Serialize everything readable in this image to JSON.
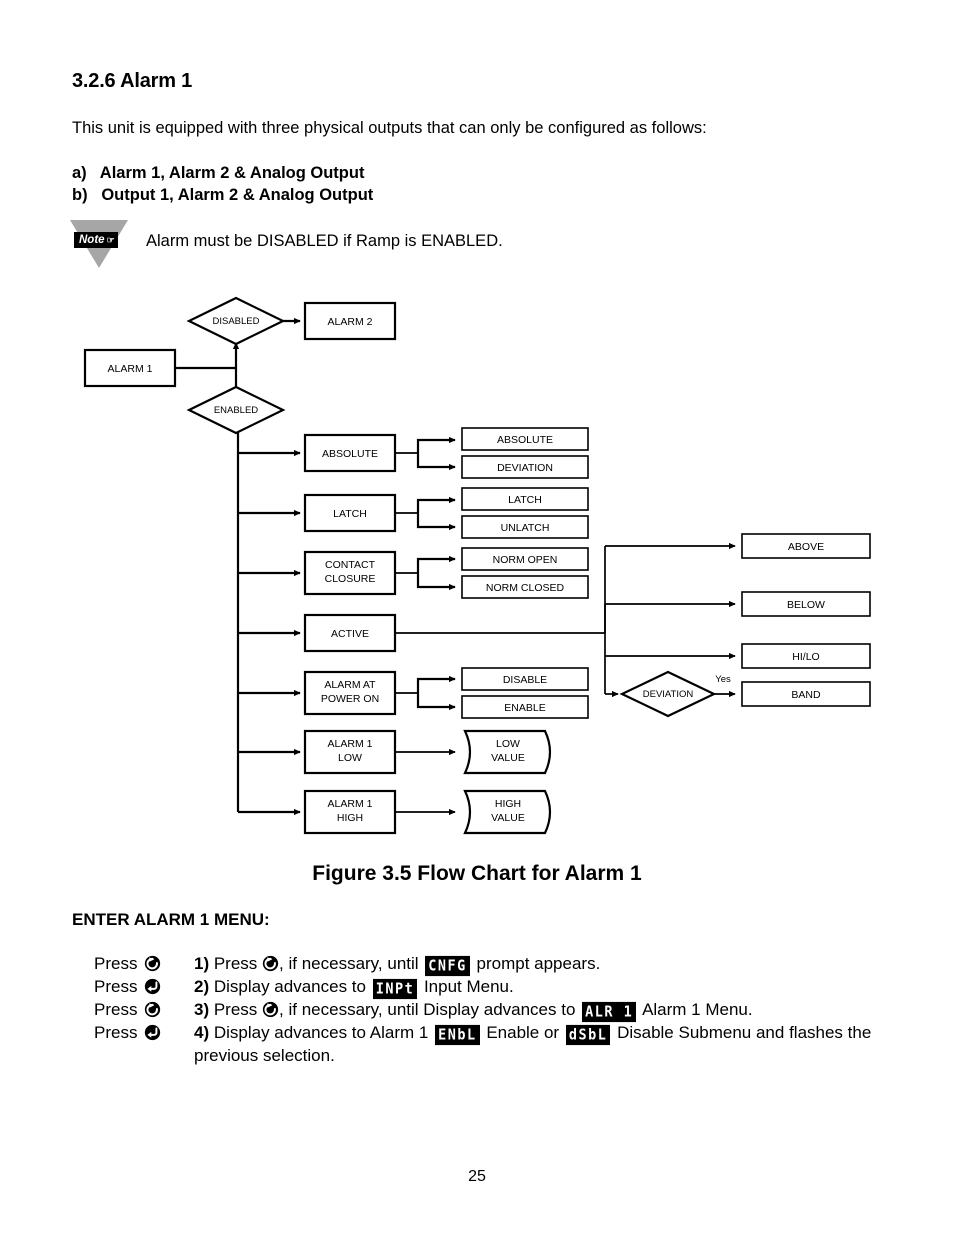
{
  "section": {
    "heading": "3.2.6 Alarm 1",
    "intro": "This unit is equipped with three physical outputs that can only be configured as follows:",
    "option_a": "a)   Alarm 1, Alarm 2 & Analog Output",
    "option_b": "b)   Output 1, Alarm 2 & Analog Output"
  },
  "note": {
    "badge_label": "Note",
    "badge_icon": "pointing-hand-icon",
    "text": "Alarm must be DISABLED if Ramp is ENABLED."
  },
  "chart_data": {
    "type": "diagram",
    "title": "Figure 3.5 Flow Chart for Alarm 1",
    "nodes": {
      "start": "ALARM 1",
      "decision_disabled": "DISABLED",
      "decision_enabled": "ENABLED",
      "alarm2": "ALARM 2",
      "menu_items": [
        "ABSOLUTE",
        "LATCH",
        "CONTACT CLOSURE",
        "ACTIVE",
        "ALARM AT POWER ON",
        "ALARM 1 LOW",
        "ALARM 1 HIGH"
      ],
      "options": [
        "ABSOLUTE",
        "DEVIATION",
        "LATCH",
        "UNLATCH",
        "NORM OPEN",
        "NORM CLOSED",
        "DISABLE",
        "ENABLE"
      ],
      "values": [
        "LOW VALUE",
        "HIGH VALUE"
      ],
      "active_results": [
        "ABOVE",
        "BELOW",
        "HI/LO",
        "BAND"
      ],
      "deviation_decision": "DEVIATION",
      "deviation_yes": "Yes"
    }
  },
  "figure_caption": "Figure 3.5 Flow Chart for Alarm 1",
  "menu_heading": "ENTER ALARM 1 MENU:",
  "steps": [
    {
      "press_label": "Press",
      "press_icon": "rotate-arrow-key-icon",
      "num": "1)",
      "parts": [
        {
          "t": "text",
          "v": " Press "
        },
        {
          "t": "icon",
          "v": "rotate-arrow-key-icon"
        },
        {
          "t": "text",
          "v": ", if necessary, until "
        },
        {
          "t": "led",
          "v": "CNFG"
        },
        {
          "t": "text",
          "v": " prompt appears."
        }
      ]
    },
    {
      "press_label": "Press",
      "press_icon": "enter-arrow-key-icon",
      "num": "2)",
      "parts": [
        {
          "t": "text",
          "v": " Display advances to "
        },
        {
          "t": "led",
          "v": "INPt"
        },
        {
          "t": "text",
          "v": " Input Menu."
        }
      ]
    },
    {
      "press_label": "Press",
      "press_icon": "rotate-arrow-key-icon",
      "num": "3)",
      "parts": [
        {
          "t": "text",
          "v": " Press "
        },
        {
          "t": "icon",
          "v": "rotate-arrow-key-icon"
        },
        {
          "t": "text",
          "v": ", if necessary, until Display advances to "
        },
        {
          "t": "led",
          "v": "ALR 1"
        },
        {
          "t": "text",
          "v": " Alarm 1 Menu."
        }
      ]
    },
    {
      "press_label": "Press",
      "press_icon": "enter-arrow-key-icon",
      "num": "4)",
      "parts": [
        {
          "t": "text",
          "v": " Display advances to Alarm 1 "
        },
        {
          "t": "led",
          "v": "ENbL"
        },
        {
          "t": "text",
          "v": " Enable or "
        },
        {
          "t": "led",
          "v": "dSbL"
        },
        {
          "t": "text",
          "v": " Disable Submenu and flashes the previous selection."
        }
      ]
    }
  ],
  "page_number": "25"
}
